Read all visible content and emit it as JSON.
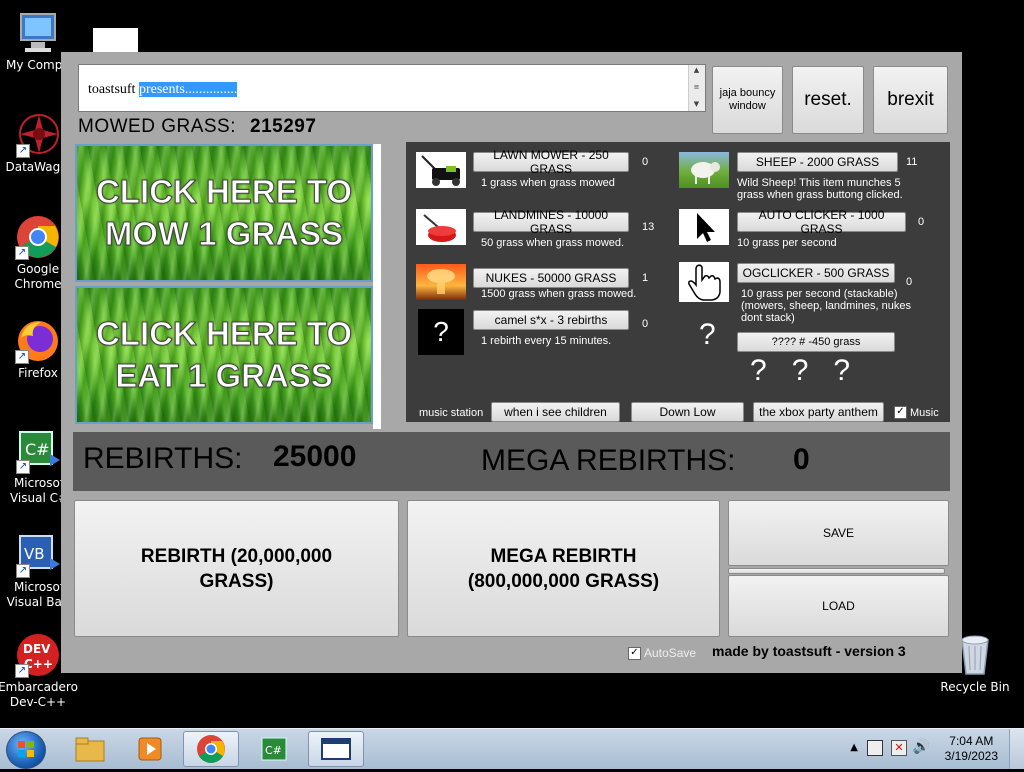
{
  "desktop": {
    "icons": [
      {
        "label": "My Compu"
      },
      {
        "label": "DataWagor"
      },
      {
        "label": "Google Chrome"
      },
      {
        "label": "Firefox"
      },
      {
        "label": "Microsof Visual C#"
      },
      {
        "label": "Microsof Visual Basi"
      },
      {
        "label": "Embarcadero Dev-C++"
      },
      {
        "label": "Recycle Bin"
      }
    ]
  },
  "app": {
    "textbox": {
      "prefix": "toastsuft ",
      "selected": "presents..............."
    },
    "buttons": {
      "jaja": "jaja bouncy window",
      "reset": "reset.",
      "brexit": "brexit"
    },
    "mowed": {
      "label": "MOWED GRASS:",
      "value": "215297"
    },
    "grass_buttons": {
      "mow": "CLICK HERE TO MOW 1 GRASS",
      "eat": "CLICK HERE TO EAT 1 GRASS"
    },
    "shop": {
      "left": [
        {
          "button": "LAWN MOWER - 250 GRASS",
          "count": "0",
          "desc": "1 grass when grass mowed",
          "icon": "lawn-mower-icon"
        },
        {
          "button": "LANDMINES - 10000 GRASS",
          "count": "13",
          "desc": "50 grass when grass mowed.",
          "icon": "landmine-icon"
        },
        {
          "button": "NUKES - 50000 GRASS",
          "count": "1",
          "desc": "1500 grass when grass mowed.",
          "icon": "nuke-icon"
        },
        {
          "button": "camel s*x - 3 rebirths",
          "count": "0",
          "desc": "1 rebirth every 15 minutes.",
          "icon": "question-icon"
        }
      ],
      "right": [
        {
          "button": "SHEEP - 2000 GRASS",
          "count": "11",
          "desc": "Wild Sheep! This item munches 5 grass when grass buttong clicked.",
          "icon": "sheep-icon"
        },
        {
          "button": "AUTO CLICKER - 1000 GRASS",
          "count": "0",
          "desc": "10 grass per second",
          "icon": "cursor-icon"
        },
        {
          "button": "OGCLICKER - 500 GRASS",
          "count": "0",
          "desc": "10 grass per second (stackable) (mowers, sheep, landmines, nukes dont stack)",
          "icon": "hand-cursor-icon"
        },
        {
          "button": "???? # -450 grass",
          "count": "",
          "desc": "",
          "icon": "question-mark"
        }
      ],
      "question_marks": "?   ?   ?",
      "music": {
        "label": "music station",
        "tracks": [
          "when i see children",
          "Down Low",
          "the xbox party anthem"
        ],
        "checkbox_label": "Music",
        "checked": true
      }
    },
    "rebirths": {
      "label": "REBIRTHS:",
      "value": "25000",
      "mega_label": "MEGA REBIRTHS:",
      "mega_value": "0"
    },
    "big_buttons": {
      "rebirth": "REBIRTH (20,000,000 GRASS)",
      "mega": "MEGA REBIRTH (800,000,000 GRASS)",
      "save": "SAVE",
      "load": "LOAD"
    },
    "autosave": {
      "label": "AutoSave",
      "checked": true
    },
    "madeby": "made by toastsuft - version 3"
  },
  "taskbar": {
    "clock": {
      "time": "7:04 AM",
      "date": "3/19/2023"
    }
  }
}
